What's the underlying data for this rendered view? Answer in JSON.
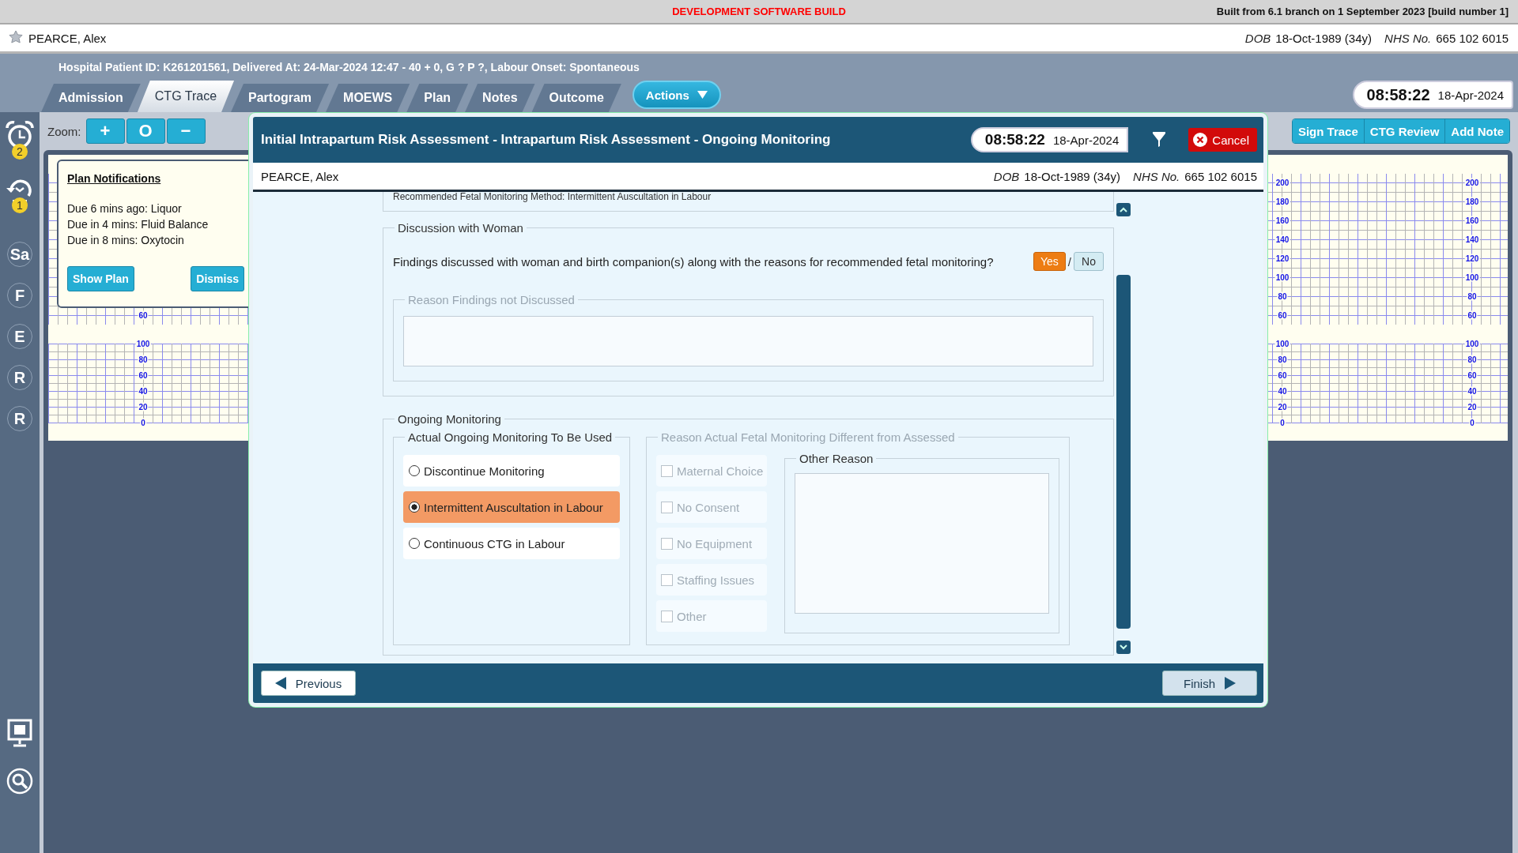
{
  "build_bar": {
    "label": "DEVELOPMENT SOFTWARE BUILD",
    "build_info": "Built from 6.1 branch on 1 September 2023 [build number 1]"
  },
  "patient": {
    "name": "PEARCE, Alex",
    "dob_label": "DOB",
    "dob": "18-Oct-1989 (34y)",
    "nhs_label": "NHS No.",
    "nhs": "665 102 6015"
  },
  "episode_info": "Hospital Patient ID: K261201561, Delivered At: 24-Mar-2024 12:47 - 40 + 0, G ? P ?,   Labour Onset: Spontaneous",
  "tabs": [
    {
      "label": "Admission",
      "selected": false
    },
    {
      "label": "CTG Trace",
      "selected": true
    },
    {
      "label": "Partogram",
      "selected": false
    },
    {
      "label": "MOEWS",
      "selected": false
    },
    {
      "label": "Plan",
      "selected": false
    },
    {
      "label": "Notes",
      "selected": false
    },
    {
      "label": "Outcome",
      "selected": false
    }
  ],
  "actions_button": "Actions",
  "clock": {
    "time": "08:58:22",
    "date": "18-Apr-2024"
  },
  "sidebar": [
    {
      "kind": "alarm",
      "badge": "2"
    },
    {
      "kind": "history",
      "badge": "1"
    },
    {
      "kind": "letter",
      "label": "Sa"
    },
    {
      "kind": "letter",
      "label": "F"
    },
    {
      "kind": "letter",
      "label": "E"
    },
    {
      "kind": "letter",
      "label": "R"
    },
    {
      "kind": "letter",
      "label": "R"
    },
    {
      "kind": "monitor"
    },
    {
      "kind": "search"
    }
  ],
  "zoom": {
    "label": "Zoom:",
    "buttons": [
      "+",
      "O",
      "−"
    ]
  },
  "trace_buttons": [
    "Sign Trace",
    "CTG Review",
    "Add Note"
  ],
  "ctg_axes": [
    {
      "fhr_ticks": [
        "60"
      ],
      "toco_ticks": [
        "100",
        "80",
        "60",
        "40",
        "20",
        "0"
      ]
    },
    {
      "fhr_ticks": [
        "200",
        "180",
        "160",
        "140",
        "120",
        "100",
        "80",
        "60"
      ],
      "toco_ticks": [
        "100",
        "80",
        "60",
        "40",
        "20",
        "0"
      ]
    },
    {
      "fhr_ticks": [
        "200",
        "180",
        "160",
        "140",
        "120",
        "100",
        "80",
        "60"
      ],
      "toco_ticks": [
        "100",
        "80",
        "60",
        "40",
        "20",
        "0"
      ]
    }
  ],
  "plan_notifications": {
    "title": "Plan Notifications",
    "items": [
      "Due 6 mins ago: Liquor",
      "Due in 4 mins: Fluid Balance",
      "Due in 8 mins: Oxytocin"
    ],
    "show_plan": "Show Plan",
    "dismiss": "Dismiss"
  },
  "modal": {
    "title": "Initial Intrapartum Risk Assessment - Intrapartum Risk Assessment - Ongoing Monitoring",
    "clock": {
      "time": "08:58:22",
      "date": "18-Apr-2024"
    },
    "cancel": "Cancel",
    "patient": {
      "name": "PEARCE, Alex",
      "dob_label": "DOB",
      "dob": "18-Oct-1989 (34y)",
      "nhs_label": "NHS No.",
      "nhs": "665 102 6015"
    },
    "recommended_text": "Recommended Fetal Monitoring Method: Intermittent Auscultation in Labour",
    "discussion": {
      "legend": "Discussion with Woman",
      "question": "Findings discussed with woman and birth companion(s) along with the reasons for recommended fetal monitoring?",
      "answers": [
        {
          "label": "Yes",
          "selected": true
        },
        {
          "label": "No",
          "selected": false
        }
      ],
      "separator": "/",
      "reason": {
        "legend": "Reason Findings not Discussed",
        "disabled": true
      }
    },
    "ongoing": {
      "legend": "Ongoing Monitoring",
      "used_legend": "Actual Ongoing Monitoring To Be Used",
      "options": [
        {
          "label": "Discontinue Monitoring",
          "selected": false
        },
        {
          "label": "Intermittent Auscultation in Labour",
          "selected": true
        },
        {
          "label": "Continuous CTG in Labour",
          "selected": false
        }
      ],
      "reasons": {
        "legend": "Reason Actual Fetal Monitoring Different from Assessed",
        "disabled": true,
        "checkboxes": [
          {
            "label": "Maternal Choice",
            "checked": false
          },
          {
            "label": "No Consent",
            "checked": false
          },
          {
            "label": "No Equipment",
            "checked": false
          },
          {
            "label": "Staffing Issues",
            "checked": false
          },
          {
            "label": "Other",
            "checked": false
          }
        ],
        "other_legend": "Other Reason"
      }
    },
    "previous": "Previous",
    "finish": "Finish"
  }
}
